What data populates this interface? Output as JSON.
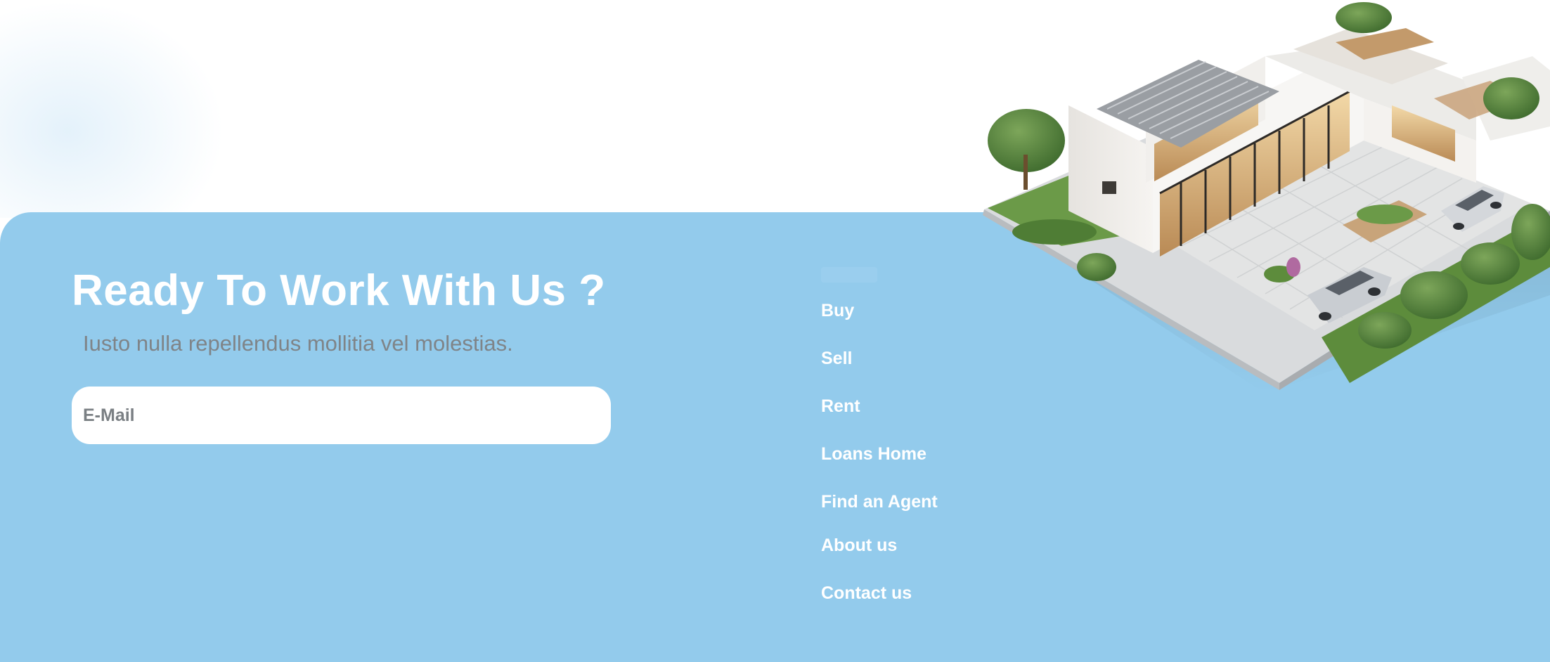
{
  "cta": {
    "title": "Ready To Work With Us ?",
    "subtitle": "Iusto nulla repellendus mollitia vel molestias.",
    "email_placeholder": "E-Mail"
  },
  "nav": {
    "items": [
      {
        "label": "Buy"
      },
      {
        "label": "Sell"
      },
      {
        "label": "Rent"
      },
      {
        "label": "Loans Home"
      },
      {
        "label": "Find an Agent"
      },
      {
        "label": "About us"
      },
      {
        "label": "Contact us"
      }
    ]
  },
  "colors": {
    "band": "#93cbec",
    "heading": "#ffffff",
    "subtitle": "#7f8488",
    "link": "#ffffff",
    "input_bg": "#ffffff"
  },
  "illustration": {
    "icon": "isometric-house-illustration"
  }
}
